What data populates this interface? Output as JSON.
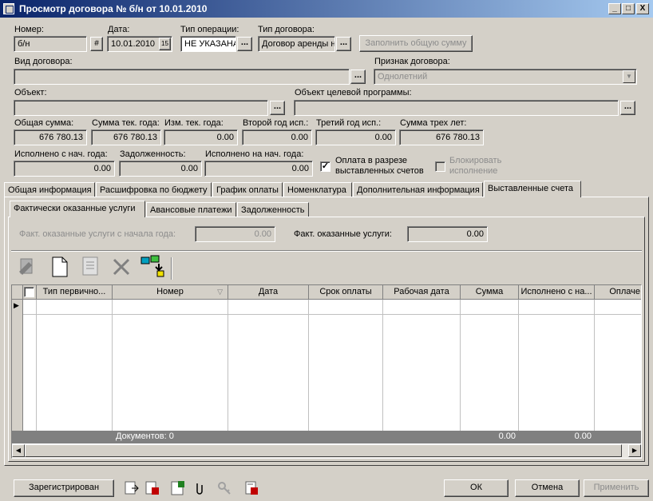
{
  "window": {
    "title": "Просмотр договора № б/н от 10.01.2010",
    "controls": {
      "minimize": "_",
      "maximize": "□",
      "close": "X"
    }
  },
  "header": {
    "number_label": "Номер:",
    "number_value": "б/н",
    "date_label": "Дата:",
    "date_value": "10.01.2010",
    "operation_type_label": "Тип операции:",
    "operation_type_value": "НЕ УКАЗАНА",
    "contract_type_label": "Тип договора:",
    "contract_type_value": "Договор аренды н",
    "fill_total_button": "Заполнить общую сумму",
    "contract_kind_label": "Вид договора:",
    "contract_kind_value": "",
    "contract_sign_label": "Признак договора:",
    "contract_sign_value": "Однолетний",
    "object_label": "Объект:",
    "object_value": "",
    "target_program_object_label": "Объект целевой программы:",
    "target_program_object_value": "",
    "ellipsis": "..."
  },
  "sums": {
    "total_label": "Общая сумма:",
    "total_value": "676 780.13",
    "current_year_label": "Сумма тек. года:",
    "current_year_value": "676 780.13",
    "change_current_year_label": "Изм. тек. года:",
    "change_current_year_value": "0.00",
    "second_year_label": "Второй год исп.:",
    "second_year_value": "0.00",
    "third_year_label": "Третий год исп.:",
    "third_year_value": "0.00",
    "three_years_label": "Сумма трех лет:",
    "three_years_value": "676 780.13",
    "executed_ytd_label": "Исполнено с нач. года:",
    "executed_ytd_value": "0.00",
    "debt_label": "Задолженность:",
    "debt_value": "0.00",
    "executed_start_label": "Исполнено на нач. года:",
    "executed_start_value": "0.00",
    "payment_by_invoices_label": "Оплата в разрезе выставленных счетов",
    "payment_by_invoices_checked": true,
    "block_execution_label": "Блокировать исполнение",
    "block_execution_checked": false
  },
  "tabs": [
    {
      "label": "Общая информация",
      "active": false
    },
    {
      "label": "Расшифровка по бюджету",
      "active": false
    },
    {
      "label": "График оплаты",
      "active": false
    },
    {
      "label": "Номенклатура",
      "active": false
    },
    {
      "label": "Дополнительная информация",
      "active": false
    },
    {
      "label": "Выставленные счета",
      "active": true
    }
  ],
  "subtabs": [
    {
      "label": "Фактически оказанные услуги",
      "active": true
    },
    {
      "label": "Авансовые платежи",
      "active": false
    },
    {
      "label": "Задолженность",
      "active": false
    }
  ],
  "services": {
    "ytd_label": "Факт. оказанные услуги с начала года:",
    "ytd_value": "0.00",
    "actual_label": "Факт. оказанные услуги:",
    "actual_value": "0.00"
  },
  "toolbar": {
    "icons": [
      "edit-icon",
      "new-document-icon",
      "properties-icon",
      "delete-icon",
      "transfer-icon"
    ]
  },
  "grid": {
    "columns": [
      "Тип первично...",
      "Номер",
      "Дата",
      "Срок оплаты",
      "Рабочая дата",
      "Сумма",
      "Исполнено с на...",
      "Оплаче"
    ],
    "footer_docs": "Документов: 0",
    "footer_sum": "0.00",
    "footer_executed": "0.00"
  },
  "bottom": {
    "registered_button": "Зарегистрирован",
    "ok_button": "ОК",
    "cancel_button": "Отмена",
    "apply_button": "Применить"
  }
}
